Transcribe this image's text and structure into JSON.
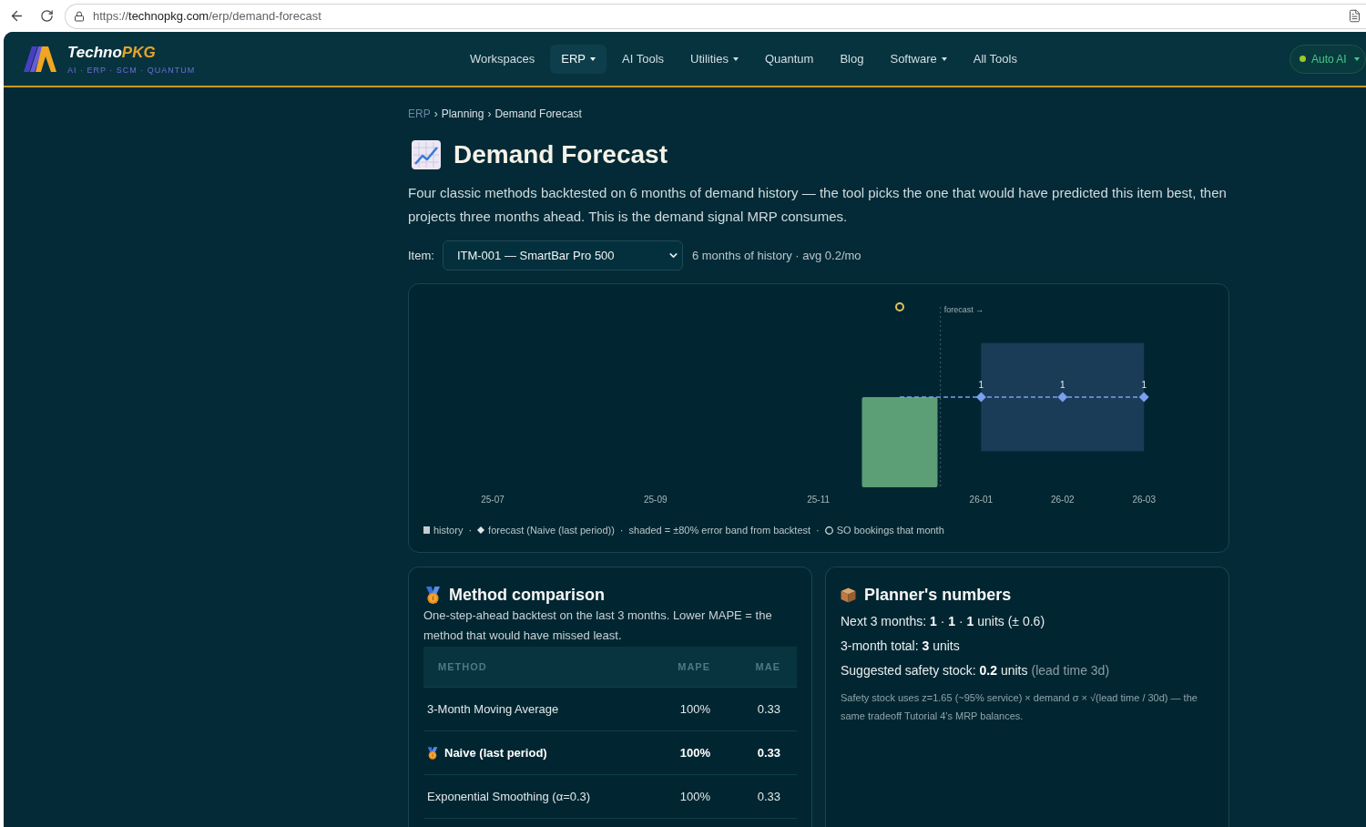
{
  "browser": {
    "url": {
      "scheme": "https://",
      "host": "technopkg.com",
      "path": "/erp/demand-forecast"
    }
  },
  "header": {
    "brand": {
      "parts": [
        "Techno",
        "PKG"
      ],
      "tagline": "AI · ERP · SCM · QUANTUM"
    },
    "nav": [
      {
        "label": "Workspaces",
        "dropdown": false,
        "selected": false
      },
      {
        "label": "ERP",
        "dropdown": true,
        "selected": true
      },
      {
        "label": "AI Tools",
        "dropdown": false,
        "selected": false
      },
      {
        "label": "Utilities",
        "dropdown": true,
        "selected": false
      },
      {
        "label": "Quantum",
        "dropdown": false,
        "selected": false
      },
      {
        "label": "Blog",
        "dropdown": false,
        "selected": false
      },
      {
        "label": "Software",
        "dropdown": true,
        "selected": false
      },
      {
        "label": "All Tools",
        "dropdown": false,
        "selected": false
      }
    ],
    "mode_switch": {
      "label": "Auto AI",
      "on": true,
      "dropdown": true
    }
  },
  "breadcrumb": {
    "separator": "›",
    "items": [
      {
        "label": "ERP",
        "kind": "link"
      },
      {
        "label": "Planning",
        "kind": "text"
      },
      {
        "label": "Demand Forecast",
        "kind": "text"
      }
    ]
  },
  "title": "Demand Forecast",
  "intro": "Four classic methods backtested on 6 months of demand history — the tool picks the one that would have predicted this item best, then projects three months ahead. This is the demand signal MRP consumes.",
  "item_picker": {
    "label": "Item:",
    "value": "ITM-001 — SmartBar Pro 500",
    "summary": "6 months of history · avg 0.2/mo"
  },
  "chart": {
    "divider_label": "forecast →",
    "history_labels": [
      "25-07",
      "25-09",
      "25-11"
    ],
    "forecast_points": [
      {
        "month": "26-01",
        "label": "1"
      },
      {
        "month": "26-02",
        "label": "1"
      },
      {
        "month": "26-03",
        "label": "1"
      }
    ],
    "legend": {
      "separator": "·",
      "items": [
        {
          "kind": "bar",
          "label": "history"
        },
        {
          "kind": "diamond",
          "label": "forecast (Naive (last period))"
        },
        {
          "kind": "plain",
          "label": "shaded = ±80% error band from backtest"
        },
        {
          "kind": "ring",
          "label": "SO bookings that month"
        }
      ]
    }
  },
  "method_comparison": {
    "title": "Method comparison",
    "description": "One-step-ahead backtest on the last 3 months. Lower MAPE = the method that would have missed least.",
    "columns": [
      "METHOD",
      "MAPE",
      "MAE"
    ],
    "rows": [
      {
        "method": "3-Month Moving Average",
        "mape": "100%",
        "mae": "0.33",
        "best": false
      },
      {
        "method": "Naive (last period)",
        "mape": "100%",
        "mae": "0.33",
        "best": true
      },
      {
        "method": "Exponential Smoothing (α=0.3)",
        "mape": "100%",
        "mae": "0.33",
        "best": false
      }
    ]
  },
  "planner": {
    "title": "Planner's numbers",
    "lines": [
      {
        "text": "Next 3 months: **1** · **1** · **1** units (± 0.6)"
      },
      {
        "text": "3-month total: **3** units"
      },
      {
        "text": "Suggested safety stock: **0.2** units",
        "aside": "(lead time 3d)"
      }
    ],
    "footnote": "Safety stock uses z=1.65 (~95% service) × demand σ × √(lead time / 30d) — the same tradeoff Tutorial 4's MRP balances."
  }
}
